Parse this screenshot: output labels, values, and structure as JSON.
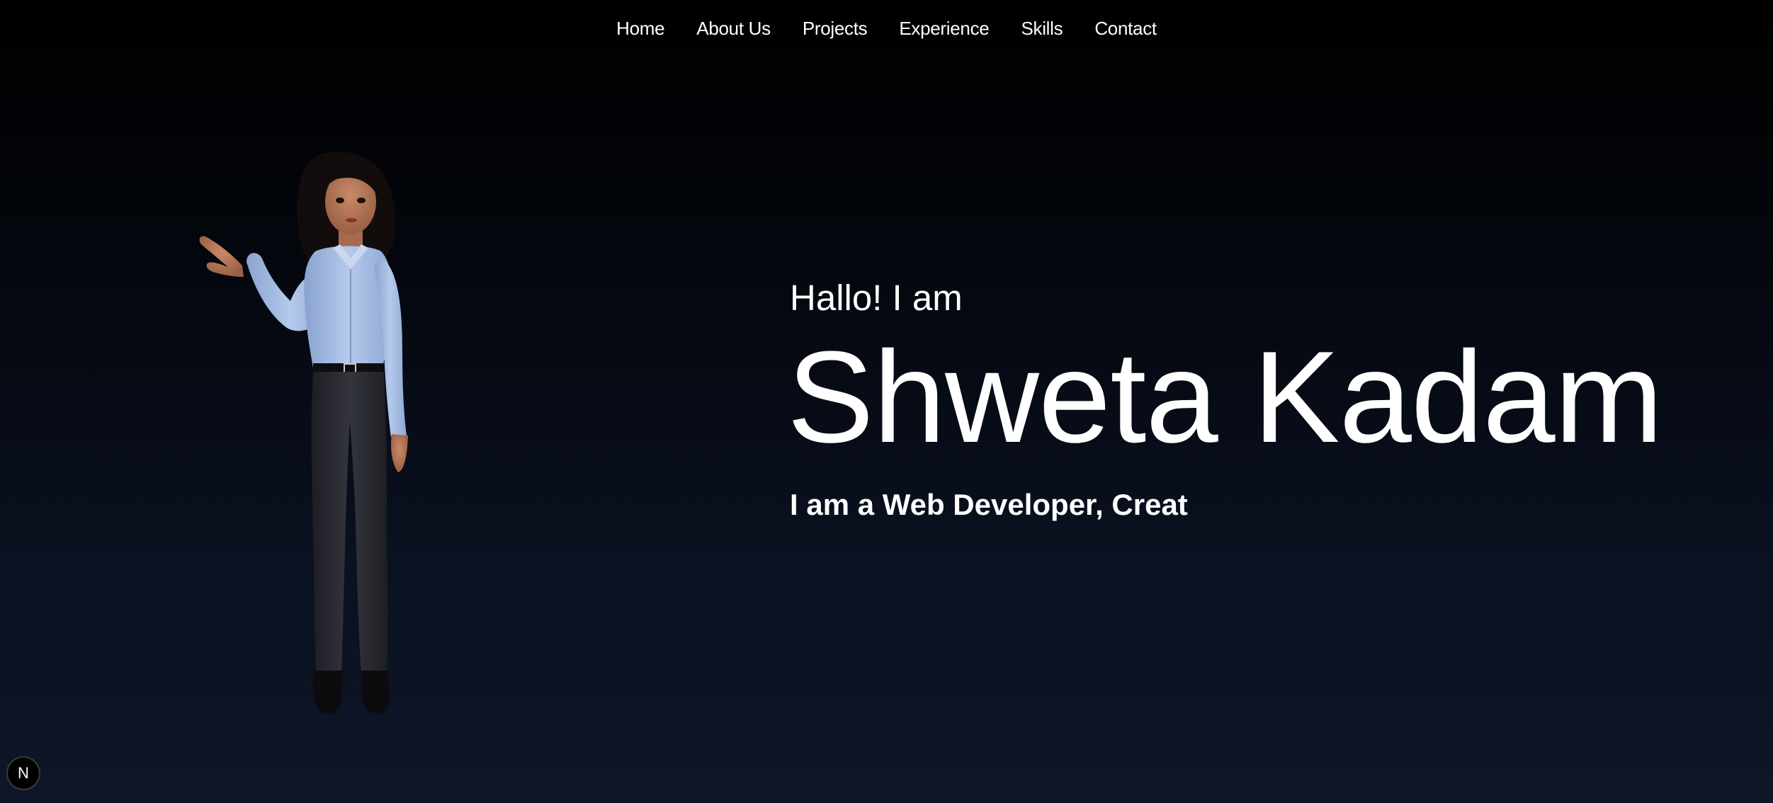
{
  "nav": {
    "items": [
      {
        "label": "Home"
      },
      {
        "label": "About Us"
      },
      {
        "label": "Projects"
      },
      {
        "label": "Experience"
      },
      {
        "label": "Skills"
      },
      {
        "label": "Contact"
      }
    ]
  },
  "hero": {
    "greeting": "Hallo! I am",
    "name": "Shweta Kadam",
    "tagline": "I am a Web Developer, Creat"
  },
  "avatar": {
    "icon": "waving-woman-3d-avatar",
    "shirt_color": "#a9c0e6",
    "pants_color": "#2b2c33",
    "skin_color": "#b9795a",
    "hair_color": "#120d0c"
  },
  "dev_badge": {
    "icon": "nextjs-icon",
    "label": "N"
  },
  "colors": {
    "background_top": "#000000",
    "background_bottom": "#0e1628",
    "text": "#ffffff"
  }
}
